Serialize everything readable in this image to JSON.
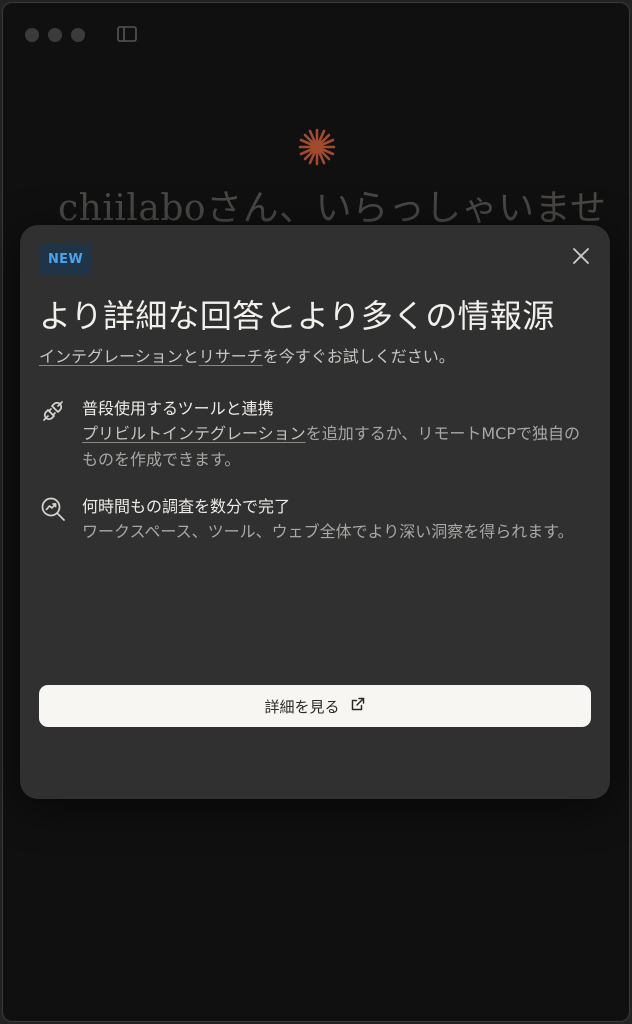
{
  "background": {
    "greeting": "chiilaboさん、いらっしゃいませ",
    "logo_icon": "starburst-logo-icon",
    "accent_color": "#c96442"
  },
  "modal": {
    "badge": "NEW",
    "title": "より詳細な回答とより多くの情報源",
    "subtitle": {
      "link1": "インテグレーション",
      "connector": "と",
      "link2": "リサーチ",
      "rest": "を今すぐお試しください。"
    },
    "features": [
      {
        "icon": "plug-icon",
        "title": "普段使用するツールと連携",
        "link": "プリビルトインテグレーション",
        "desc": "を追加するか、リモートMCPで独自のものを作成できます。"
      },
      {
        "icon": "search-trend-icon",
        "title": "何時間もの調査を数分で完了",
        "desc": "ワークスペース、ツール、ウェブ全体でより深い洞察を得られます。"
      }
    ],
    "cta_label": "詳細を見る",
    "cta_icon": "external-link-icon",
    "close_icon": "close-icon"
  }
}
